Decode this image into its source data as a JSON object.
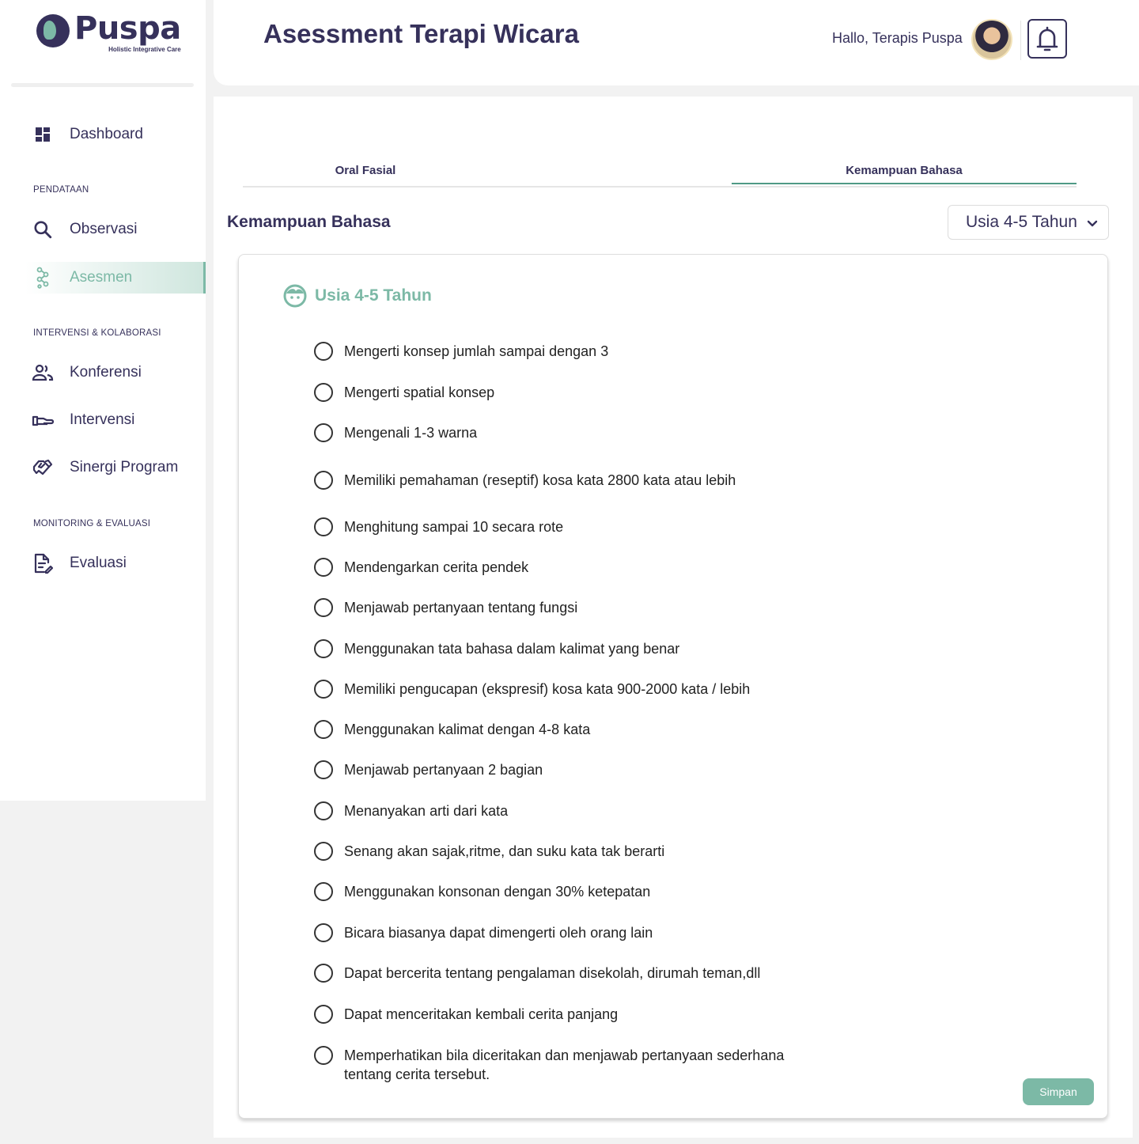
{
  "brand": {
    "name": "Puspa",
    "tagline": "Holistic Integrative Care"
  },
  "header": {
    "title": "Asessment Terapi Wicara",
    "greeting": "Hallo, Terapis Puspa"
  },
  "sidebar": {
    "dashboard": "Dashboard",
    "section_pendataan": "PENDATAAN",
    "observasi": "Observasi",
    "asesmen": "Asesmen",
    "section_intervensi": "INTERVENSI & KOLABORASI",
    "konferensi": "Konferensi",
    "intervensi": "Intervensi",
    "sinergi": "Sinergi Program",
    "section_monitoring": "MONITORING & EVALUASI",
    "evaluasi": "Evaluasi",
    "active_item": "Asesmen"
  },
  "tabs": [
    "Oral Fasial",
    "Kemampuan Bahasa"
  ],
  "active_tab": "Kemampuan Bahasa",
  "section": {
    "title": "Kemampuan Bahasa",
    "age_select": "Usia 4-5 Tahun"
  },
  "card": {
    "title": "Usia 4-5 Tahun",
    "items": [
      "Mengerti konsep jumlah sampai dengan 3",
      "Mengerti spatial konsep",
      "Mengenali 1-3 warna",
      "Memiliki pemahaman (reseptif) kosa kata 2800 kata atau lebih",
      "Menghitung sampai 10 secara rote",
      "Mendengarkan cerita pendek",
      "Menjawab pertanyaan tentang fungsi",
      "Menggunakan tata bahasa dalam kalimat yang benar",
      "Memiliki pengucapan (ekspresif) kosa kata 900-2000 kata / lebih",
      "Menggunakan kalimat dengan 4-8 kata",
      "Menjawab pertanyaan 2 bagian",
      "Menanyakan arti dari kata",
      "Senang akan sajak,ritme, dan suku kata tak berarti",
      "Menggunakan konsonan dengan 30% ketepatan",
      "Bicara biasanya dapat dimengerti oleh orang lain",
      "Dapat bercerita tentang pengalaman disekolah, dirumah teman,dll",
      "Dapat menceritakan kembali cerita panjang",
      "Memperhatikan bila diceritakan dan menjawab pertanyaan sederhana tentang cerita tersebut."
    ],
    "save_label": "Simpan"
  },
  "colors": {
    "primary": "#36315b",
    "accent": "#7cb9a6",
    "tab_underline": "#4f9a86",
    "background": "#f2f2f2"
  },
  "icons": {
    "dashboard": "dashboard-icon",
    "observasi": "search-icon",
    "asesmen": "molecule-icon",
    "konferensi": "people-icon",
    "intervensi": "hand-icon",
    "sinergi": "handshake-icon",
    "evaluasi": "edit-document-icon",
    "notification": "bell-icon",
    "dropdown": "chevron-down-icon",
    "card": "child-face-icon"
  }
}
